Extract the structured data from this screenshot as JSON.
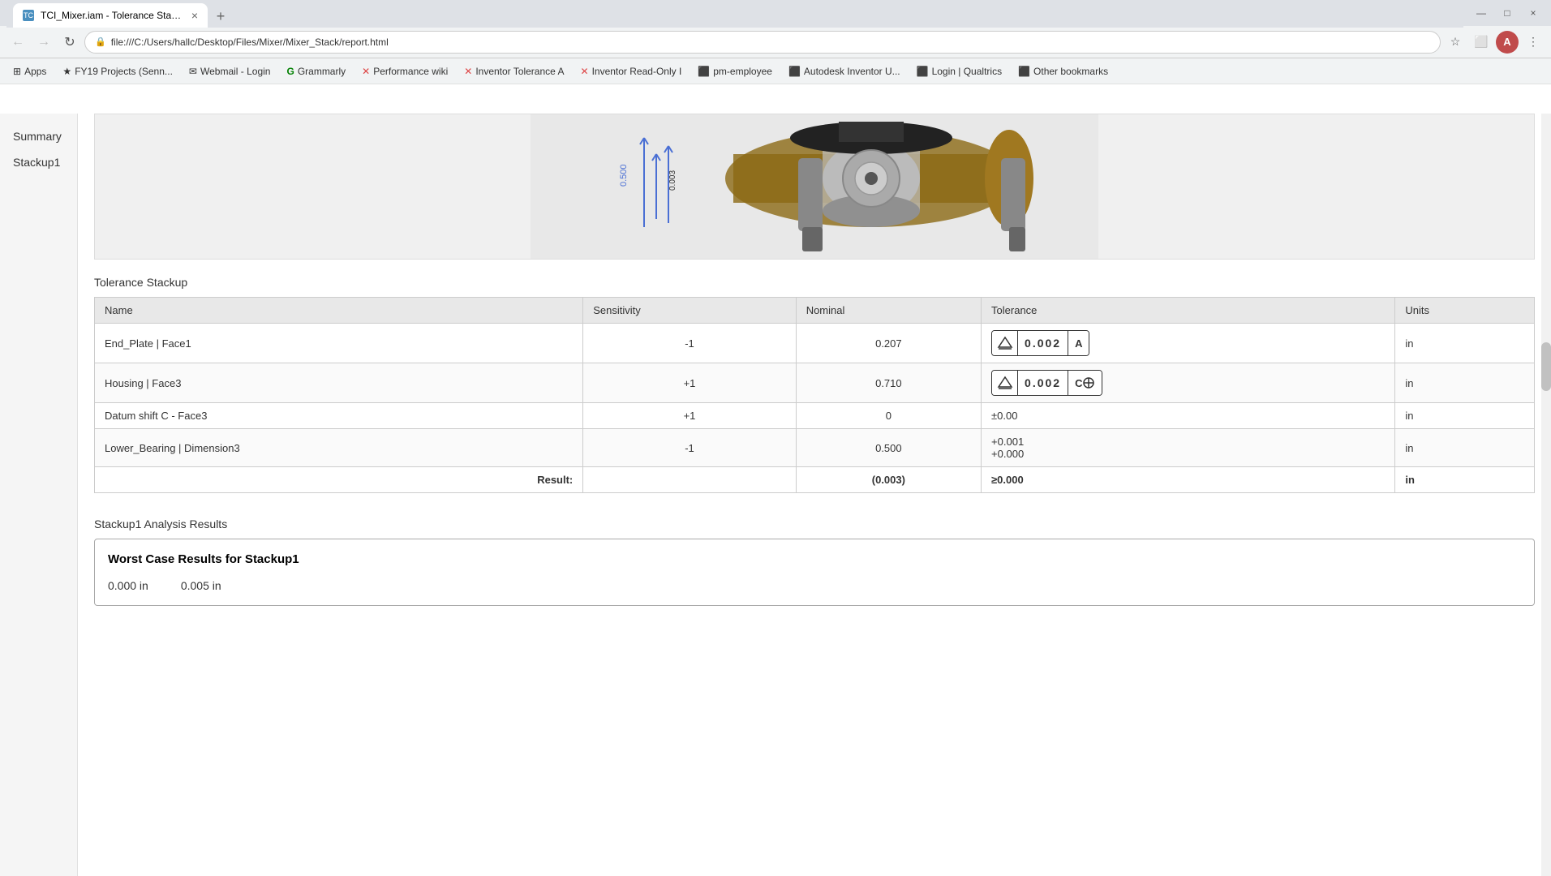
{
  "browser": {
    "tab": {
      "favicon": "TC",
      "title": "TCI_Mixer.iam - Tolerance Stacku...",
      "close": "×"
    },
    "new_tab": "+",
    "address": "file:///C:/Users/hallc/Desktop/Files/Mixer/Mixer_Stack/report.html",
    "nav": {
      "back": "←",
      "forward": "→",
      "reload": "↻",
      "home": "⌂",
      "bookmark_star": "☆",
      "extensions": "⚙",
      "profile": "A"
    },
    "bookmarks": [
      {
        "icon": "⊞",
        "label": "Apps"
      },
      {
        "icon": "★",
        "label": "FY19 Projects (Senn..."
      },
      {
        "icon": "✉",
        "label": "Webmail - Login"
      },
      {
        "icon": "G",
        "label": "Grammarly"
      },
      {
        "icon": "✕",
        "label": "Performance wiki"
      },
      {
        "icon": "✕",
        "label": "Inventor Tolerance A"
      },
      {
        "icon": "✕",
        "label": "Inventor Read-Only I"
      },
      {
        "icon": "⬛",
        "label": "pm-employee"
      },
      {
        "icon": "⬛",
        "label": "Autodesk Inventor U..."
      },
      {
        "icon": "⬛",
        "label": "Login | Qualtrics"
      },
      {
        "icon": "⬛",
        "label": "Other bookmarks"
      }
    ],
    "window_controls": [
      "—",
      "□",
      "×"
    ]
  },
  "sidebar": {
    "items": [
      {
        "label": "Summary",
        "id": "summary"
      },
      {
        "label": "Stackup1",
        "id": "stackup1"
      }
    ]
  },
  "page": {
    "tolerance_stackup_title": "Tolerance Stackup",
    "table": {
      "headers": [
        "Name",
        "Sensitivity",
        "Nominal",
        "Tolerance",
        "Units"
      ],
      "rows": [
        {
          "name": "End_Plate | Face1",
          "sensitivity": "-1",
          "nominal": "0.207",
          "tolerance_type": "badge",
          "tolerance_value": "0.002",
          "tolerance_modifier": "A",
          "units": "in"
        },
        {
          "name": "Housing | Face3",
          "sensitivity": "+1",
          "nominal": "0.710",
          "tolerance_type": "badge",
          "tolerance_value": "0.002",
          "tolerance_modifier": "C⊕",
          "units": "in"
        },
        {
          "name": "Datum shift C - Face3",
          "sensitivity": "+1",
          "nominal": "0",
          "tolerance_type": "text",
          "tolerance_value": "±0.00",
          "units": "in"
        },
        {
          "name": "Lower_Bearing | Dimension3",
          "sensitivity": "-1",
          "nominal": "0.500",
          "tolerance_type": "text",
          "tolerance_value_plus": "+0.001",
          "tolerance_value_minus": "+0.000",
          "units": "in"
        },
        {
          "name": "Result:",
          "sensitivity": "",
          "nominal": "(0.003)",
          "tolerance_type": "text",
          "tolerance_value": "≥0.000",
          "units": "in",
          "is_result": true
        }
      ]
    },
    "analysis_title": "Stackup1 Analysis Results",
    "worst_case": {
      "title": "Worst Case Results for Stackup1",
      "value1": "0.000 in",
      "value2": "0.005 in"
    }
  }
}
